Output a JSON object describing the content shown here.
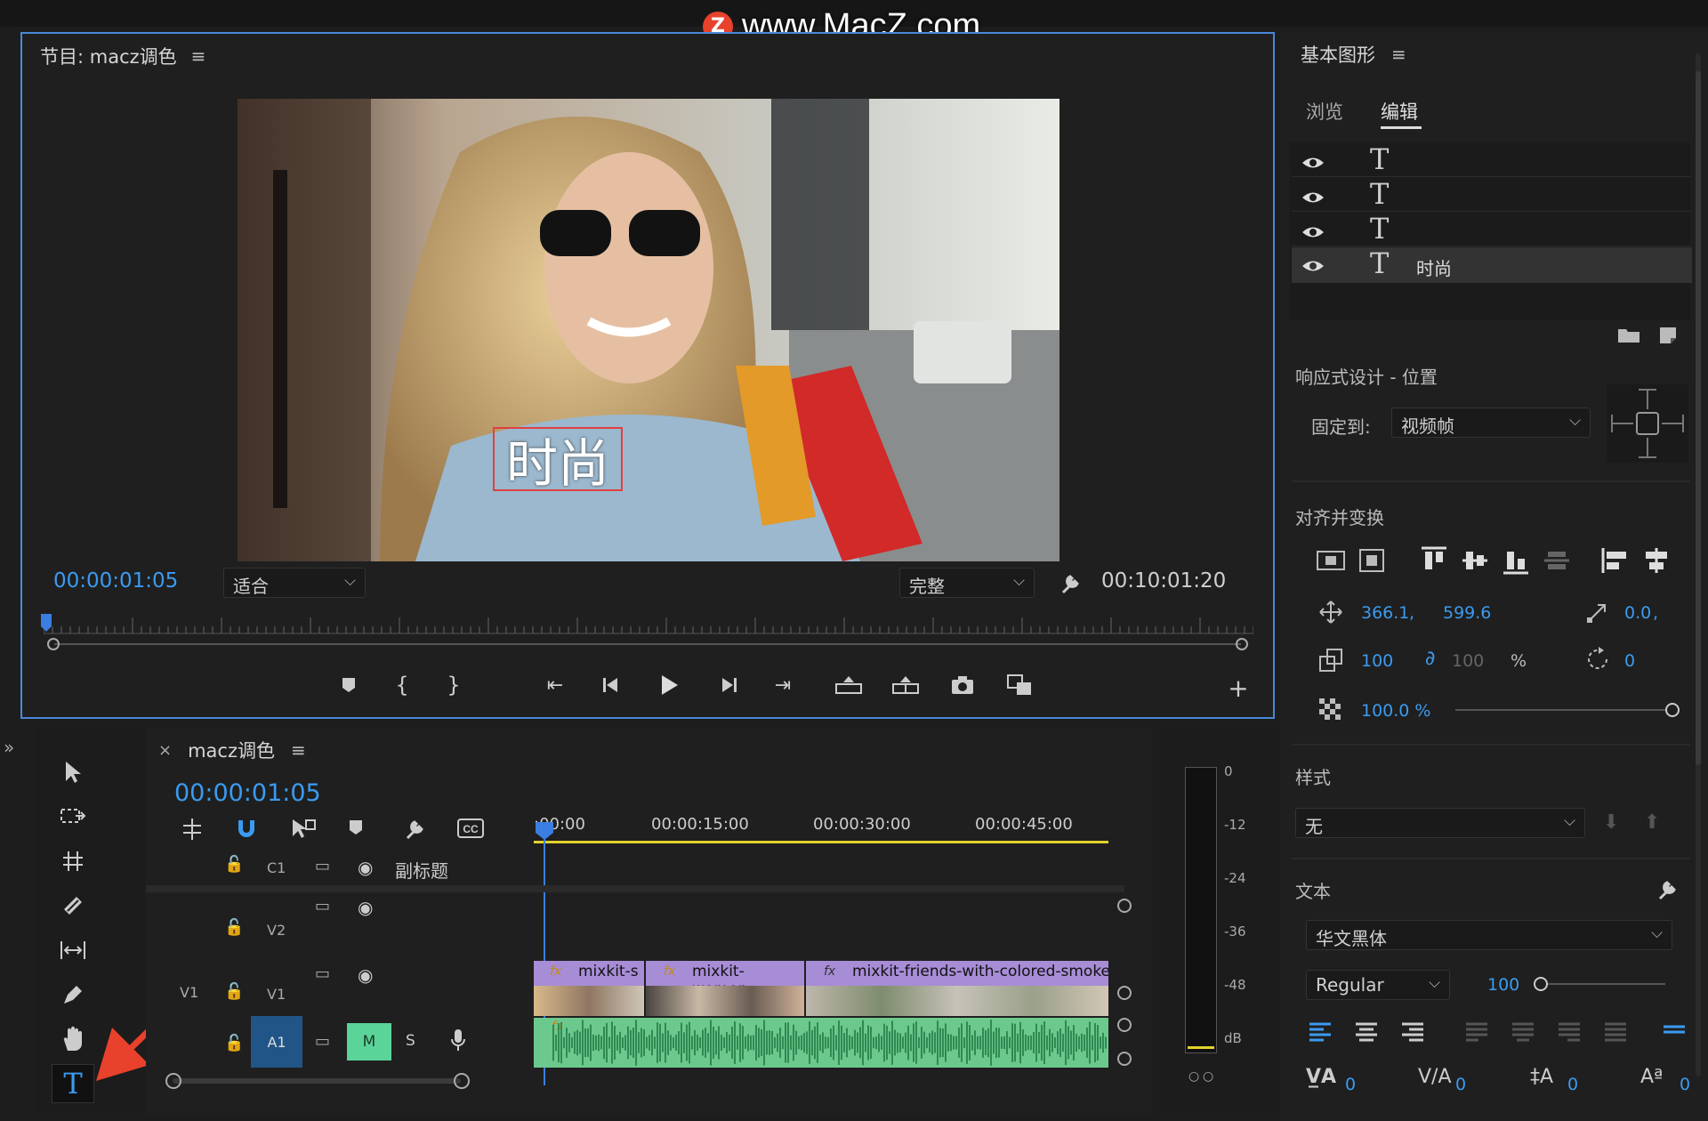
{
  "watermark": "www.MacZ.com",
  "program": {
    "title": "节目: macz调色",
    "timecode_current": "00:00:01:05",
    "fit_label": "适合",
    "quality_label": "完整",
    "timecode_total": "00:10:01:20",
    "overlay_title": "时尚"
  },
  "timeline": {
    "sequence_name": "macz调色",
    "timecode": "00:00:01:05",
    "ruler": [
      ":00:00",
      "00:00:15:00",
      "00:00:30:00",
      "00:00:45:00"
    ],
    "tracks": [
      {
        "id": "C1",
        "label": "副标题"
      },
      {
        "id": "V2"
      },
      {
        "id": "V1",
        "source": "V1"
      },
      {
        "id": "A1",
        "mute": "M",
        "solo": "S"
      }
    ],
    "clips": [
      "mixkit-s",
      "mixkit-women-",
      "mixkit-friends-with-colored-smoke-b"
    ],
    "fx_badge": "fx"
  },
  "meter": {
    "labels": [
      "0",
      "-12",
      "-24",
      "-36",
      "-48",
      "dB"
    ]
  },
  "essential_graphics": {
    "title": "基本图形",
    "tabs": [
      "浏览",
      "编辑"
    ],
    "active_tab": "编辑",
    "layers": [
      {
        "name": ""
      },
      {
        "name": ""
      },
      {
        "name": ""
      },
      {
        "name": "时尚",
        "selected": true
      }
    ],
    "responsive_label": "响应式设计 - 位置",
    "pin_label": "固定到:",
    "pin_value": "视频帧",
    "align_label": "对齐并变换",
    "pos_x": "366.1",
    "pos_y": "599.6",
    "anchor": "0.0",
    "scale": "100",
    "scale_h": "100",
    "percent_sign": "%",
    "rotation": "0",
    "opacity": "100.0 %",
    "opacity_fraction": 1.0,
    "style_label": "样式",
    "style_value": "无",
    "text_label": "文本",
    "font": "华文黑体",
    "font_style": "Regular",
    "font_size": "100",
    "kerning": "0",
    "tracking": "0",
    "leading": "0",
    "baseline": "0"
  },
  "colors": {
    "accent_blue": "#3b9bf0",
    "panel_border": "#4a88d8",
    "video_clip": "#a78cd6",
    "audio_clip": "#6cc98e",
    "mute_btn": "#5bd49a",
    "arrow_red": "#e8412c",
    "work_area": "#e2d32b"
  }
}
